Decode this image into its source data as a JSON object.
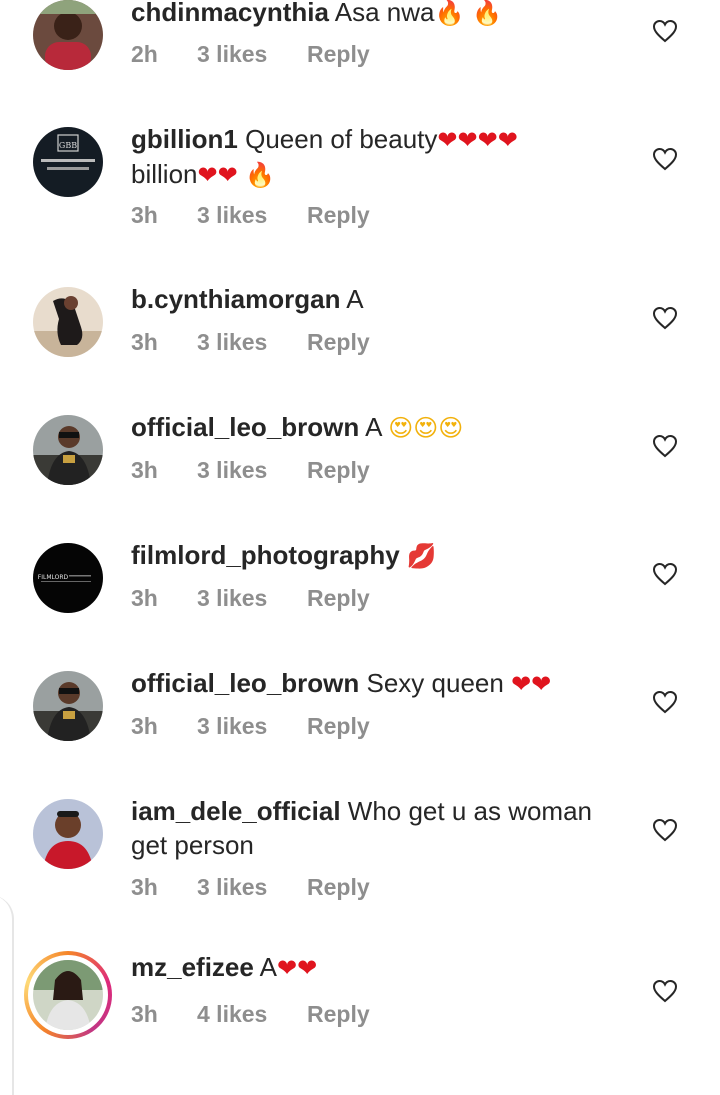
{
  "comments": [
    {
      "user": "chdinmacynthia",
      "text": "Asa nwa",
      "emoji": "🔥 🔥",
      "emoji_kind": "fire",
      "time": "2h",
      "likes": "3 likes",
      "reply": "Reply"
    },
    {
      "user": "gbillion1",
      "text": "Queen of beauty",
      "emoji": "❤❤❤❤",
      "line2": "billion",
      "line2_emoji": "❤❤ 🔥",
      "time": "3h",
      "likes": "3 likes",
      "reply": "Reply"
    },
    {
      "user": "b.cynthiamorgan",
      "text": "A",
      "time": "3h",
      "likes": "3 likes",
      "reply": "Reply"
    },
    {
      "user": "official_leo_brown",
      "text": "A",
      "emoji": "😍😍😍",
      "emoji_kind": "face",
      "time": "3h",
      "likes": "3 likes",
      "reply": "Reply"
    },
    {
      "user": "filmlord_photography",
      "text": "",
      "emoji": "💋",
      "emoji_kind": "lips",
      "time": "3h",
      "likes": "3 likes",
      "reply": "Reply"
    },
    {
      "user": "official_leo_brown",
      "text": "Sexy queen",
      "emoji": "❤❤",
      "emoji_kind": "red",
      "time": "3h",
      "likes": "3 likes",
      "reply": "Reply"
    },
    {
      "user": "iam_dele_official",
      "text": "Who get u as woman",
      "line2": "get person",
      "time": "3h",
      "likes": "3 likes",
      "reply": "Reply"
    },
    {
      "user": "mz_efizee",
      "text": "A",
      "emoji": "❤❤",
      "emoji_kind": "red",
      "time": "3h",
      "likes": "4 likes",
      "reply": "Reply"
    }
  ],
  "avatars": {
    "gbillion1_logo": "GBB",
    "filmlord_logo": "FILMLORD"
  },
  "icons": {
    "like": "heart-outline-icon"
  },
  "colors": {
    "meta_text": "#8e8e8e",
    "primary_text": "#262626",
    "story_ring": "#dd2a7b"
  }
}
